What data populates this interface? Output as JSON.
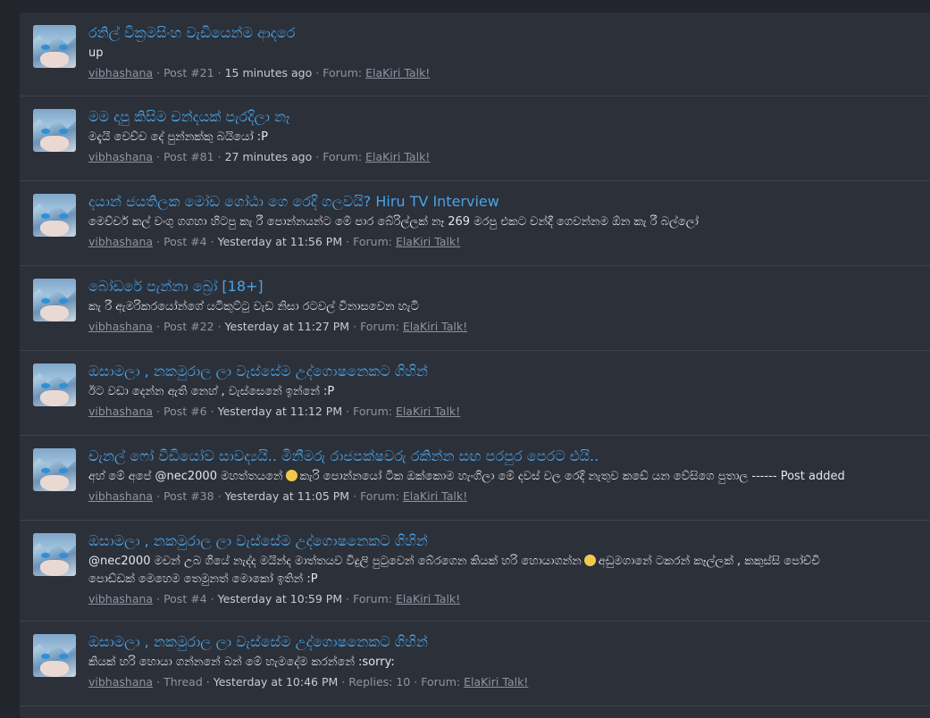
{
  "posts": [
    {
      "title": "රනිල් වික්‍රමසිංහ වැඩියෙන්ම ආදරෙ",
      "snippet": "up",
      "user": "vibhashana",
      "post": "Post #21",
      "time": "15 minutes ago",
      "forum_label": "Forum:",
      "forum": "ElaKiri Talk!"
    },
    {
      "title": "මම දාපු කිසිම චන්දයක් පැරදිලා නෑ",
      "snippet": "මදැයි වෙච්ච දේ පුන්නක්කු බයියෝ :P",
      "user": "vibhashana",
      "post": "Post #81",
      "time": "27 minutes ago",
      "forum_label": "Forum:",
      "forum": "ElaKiri Talk!"
    },
    {
      "title": "දයාන් ජයතිලක මෝඩ ගෝඨා ගෙ රෙදි ගලවයි? Hiru TV Interview",
      "snippet": "මෙච්චර් කල් වංගු ගගහා හිටපු කැ රී පොන්නයන්ට මේ පාර බේරිල්ලක් නෑ 269 මරපු එකට චන්දී ගෙවන්නම ඕන කැ රී බල්ලෝ",
      "user": "vibhashana",
      "post": "Post #4",
      "time": "Yesterday at 11:56 PM",
      "forum_label": "Forum:",
      "forum": "ElaKiri Talk!"
    },
    {
      "title": "බෝඩරේ පැන්නා බ්‍රෝ [18+]",
      "snippet": "කැ රී ඇමරිකරයෝන්ගේ යටිකුට්ටු වැඩ නිසා රටවල් විනාසවෙන හැටි",
      "user": "vibhashana",
      "post": "Post #22",
      "time": "Yesterday at 11:27 PM",
      "forum_label": "Forum:",
      "forum": "ElaKiri Talk!"
    },
    {
      "title": "ඔසාමලා , නකමුරාල ලා වැස්සේම උද්ගොෂනෙකට ගිහින්",
      "snippet": "ඊට වඩා දෙන්න ඇති නෙහ් , වැස්සෙනේ ඉන්නේ :P",
      "user": "vibhashana",
      "post": "Post #6",
      "time": "Yesterday at 11:12 PM",
      "forum_label": "Forum:",
      "forum": "ElaKiri Talk!"
    },
    {
      "title": "චැනල් ෆෝ වීඩියෝව සාවද්‍යයි.. මිනීමරු රාජපක්ෂවරු රකින්න සඟ පරපුර පෙරට එයි..",
      "snippet_pre": "අහ් මේ අපේ @nec2000 මහත්තයනේ",
      "snippet_post": "කැරි පොන්නයෝ ටික ඔක්කොම හැංගිලා මේ දවස් වල රෙදි නැතුව කඩේ යන වේසිගෙ පුතාල ------ Post added",
      "user": "vibhashana",
      "post": "Post #38",
      "time": "Yesterday at 11:05 PM",
      "forum_label": "Forum:",
      "forum": "ElaKiri Talk!"
    },
    {
      "title": "ඔසාමලා , නකමුරාල ලා වැස්සේම උද්ගොෂනෙකට ගිහින්",
      "snippet_pre": "@nec2000 මචන් උබ ගියේ නැද්ද මයින්ද මාත්තයව විදුලි පුටුවෙන් බේරගෙන කියක් හරි හොයාගන්න",
      "snippet_post": "අඩුමගානේ ටකරන් කෑල්ලක් , කකුස්සි පෝච්චි",
      "snippet2": "පොඩ්ඩක් මෙහෙම තෙමුනත් මොකෝ ඉතින් :P",
      "user": "vibhashana",
      "post": "Post #4",
      "time": "Yesterday at 10:59 PM",
      "forum_label": "Forum:",
      "forum": "ElaKiri Talk!"
    },
    {
      "title": "ඔසාමලා , නකමුරාල ලා වැස්සේම උද්ගොෂනෙකට ගිහින්",
      "snippet": "කියක් හරි හොයා ගන්නනේ බන් මේ හැමදේම කරන්නේ :sorry:",
      "user": "vibhashana",
      "post": "Thread",
      "time": "Yesterday at 10:46 PM",
      "replies": "Replies: 10",
      "forum_label": "Forum:",
      "forum": "ElaKiri Talk!"
    }
  ]
}
